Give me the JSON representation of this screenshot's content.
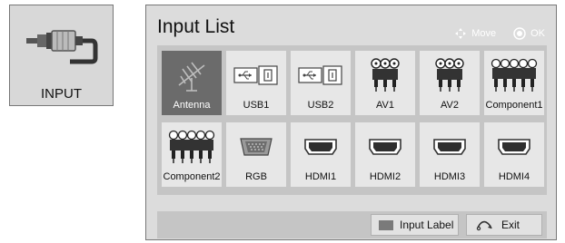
{
  "input_key": {
    "label": "INPUT",
    "icon": "rca-cable-icon"
  },
  "panel": {
    "title": "Input List",
    "hints": {
      "move": "Move",
      "ok": "OK"
    },
    "inputs": [
      {
        "label": "Antenna",
        "icon": "antenna-icon",
        "selected": true
      },
      {
        "label": "USB1",
        "icon": "usb-icon"
      },
      {
        "label": "USB2",
        "icon": "usb-icon"
      },
      {
        "label": "AV1",
        "icon": "av-connector-icon"
      },
      {
        "label": "AV2",
        "icon": "av-connector-icon"
      },
      {
        "label": "Component1",
        "icon": "component-connector-icon"
      },
      {
        "label": "Component2",
        "icon": "component-connector-icon"
      },
      {
        "label": "RGB",
        "icon": "vga-port-icon"
      },
      {
        "label": "HDMI1",
        "icon": "hdmi-port-icon"
      },
      {
        "label": "HDMI2",
        "icon": "hdmi-port-icon"
      },
      {
        "label": "HDMI3",
        "icon": "hdmi-port-icon"
      },
      {
        "label": "HDMI4",
        "icon": "hdmi-port-icon"
      }
    ],
    "footer": {
      "input_label": "Input Label",
      "exit": "Exit"
    }
  }
}
